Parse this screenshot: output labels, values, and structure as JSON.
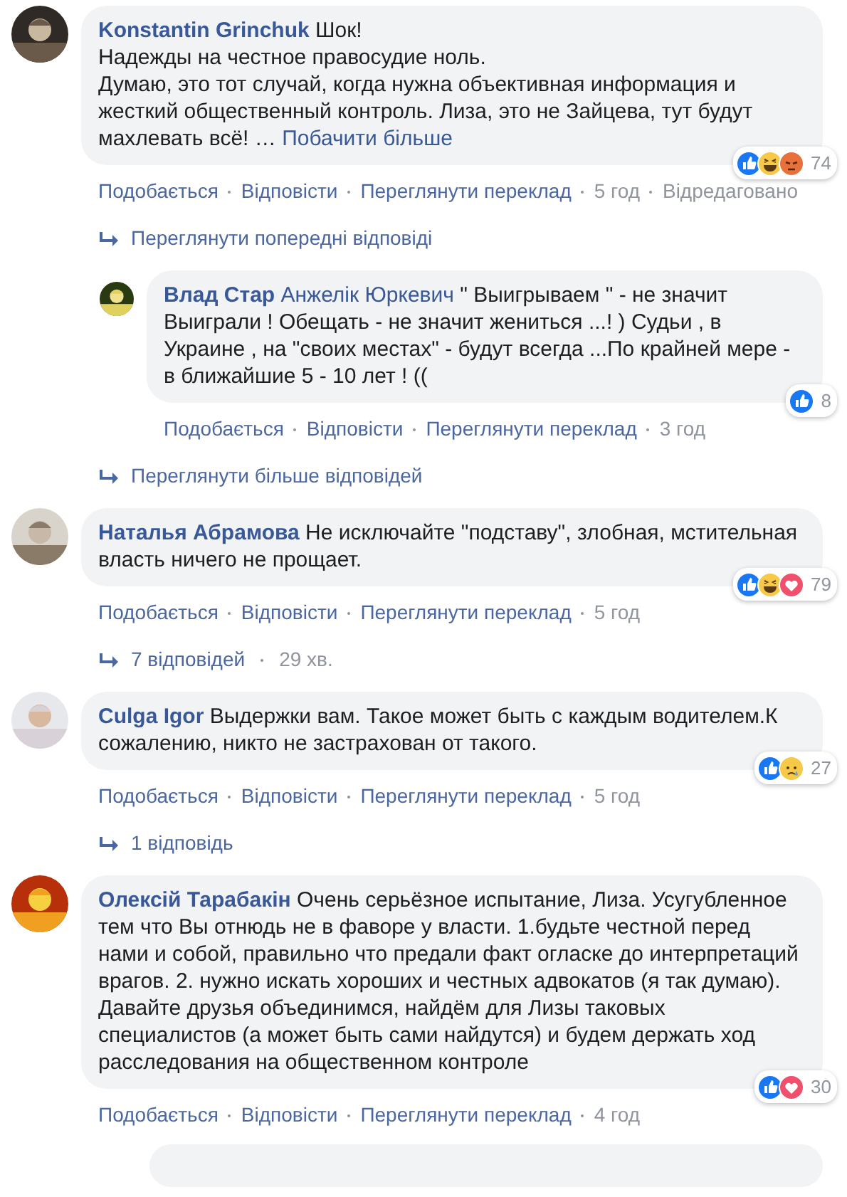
{
  "items": [
    {
      "kind": "comment",
      "author": "Konstantin Grinchuk",
      "text": "Шок!\nНадежды на честное правосудие ноль.\nДумаю, это тот случай, когда нужна объективная информация и жесткий общественный контроль. Лиза, это не Зайцева, тут будут махлевать всё! …",
      "see_more": "Побачити більше",
      "reactions": [
        {
          "kind": "like"
        },
        {
          "kind": "haha"
        },
        {
          "kind": "angry"
        }
      ],
      "count": "74",
      "actions": [
        "Подобається",
        "Відповісти",
        "Переглянути переклад"
      ],
      "time": "5 год",
      "edited": "Відредаговано"
    },
    {
      "kind": "link",
      "text": "Переглянути попередні відповіді"
    },
    {
      "kind": "reply",
      "author": "Влад Стар",
      "mention": "Анжелік Юркевич",
      "text": "\" Выигрываем \" - не значит Выиграли ! Обещать - не значит жениться ...! ) Судьи , в Украине , на \"своих местах\" - будут всегда ...По крайней мере - в ближайшие 5 - 10 лет ! ((",
      "reactions": [
        {
          "kind": "like"
        }
      ],
      "count": "8",
      "actions": [
        "Подобається",
        "Відповісти",
        "Переглянути переклад"
      ],
      "time": "3 год"
    },
    {
      "kind": "link",
      "text": "Переглянути більше відповідей"
    },
    {
      "kind": "comment",
      "author": "Наталья Абрамова",
      "text": "Не исключайте \"подставу\", злобная, мстительная власть ничего не прощает.",
      "reactions": [
        {
          "kind": "like"
        },
        {
          "kind": "haha"
        },
        {
          "kind": "love"
        }
      ],
      "count": "79",
      "actions": [
        "Подобається",
        "Відповісти",
        "Переглянути переклад"
      ],
      "time": "5 год"
    },
    {
      "kind": "link",
      "text": "7 відповідей",
      "time": "29 хв."
    },
    {
      "kind": "comment",
      "author": "Culga Igor",
      "text": "Выдержки вам. Такое может быть с каждым водителем.К сожалению, никто не застрахован от такого.",
      "reactions": [
        {
          "kind": "like"
        },
        {
          "kind": "sad"
        }
      ],
      "count": "27",
      "actions": [
        "Подобається",
        "Відповісти",
        "Переглянути переклад"
      ],
      "time": "5 год"
    },
    {
      "kind": "link",
      "text": "1 відповідь"
    },
    {
      "kind": "comment",
      "author": "Олексій Тарабакін",
      "text": "Очень серьёзное испытание, Лиза. Усугубленное тем что Вы отнюдь не в фаворе у власти. 1.будьте честной перед нами и собой, правильно что предали факт огласке до интерпретаций врагов. 2. нужно искать хороших и честных адвокатов (я так думаю). Давайте друзья объединимся, найдём для Лизы таковых специалистов (а может быть сами найдутся) и будем держать ход расследования на общественном контроле",
      "reactions": [
        {
          "kind": "like"
        },
        {
          "kind": "love"
        }
      ],
      "count": "30",
      "actions": [
        "Подобається",
        "Відповісти",
        "Переглянути переклад"
      ],
      "time": "4 год"
    },
    {
      "kind": "stub"
    }
  ]
}
